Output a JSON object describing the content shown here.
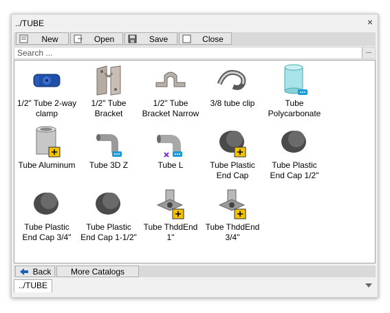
{
  "window": {
    "title": "../TUBE",
    "close_glyph": "×"
  },
  "toolbar": {
    "new_label": "New",
    "open_label": "Open",
    "save_label": "Save",
    "close_label": "Close"
  },
  "search": {
    "placeholder": "Search ...",
    "value": "",
    "options_label": "..."
  },
  "items": [
    {
      "label": "1/2\" Tube  2-way clamp",
      "icon": "blue-clamp"
    },
    {
      "label": "1/2\" Tube Bracket",
      "icon": "bracket"
    },
    {
      "label": "1/2\" Tube Bracket Narrow",
      "icon": "bracket-narrow"
    },
    {
      "label": "3/8 tube clip",
      "icon": "clip"
    },
    {
      "label": "Tube Polycarbonate",
      "icon": "polycarbonate-tube"
    },
    {
      "label": "Tube Aluminum",
      "icon": "aluminum-tube"
    },
    {
      "label": "Tube 3D Z",
      "icon": "elbow-z"
    },
    {
      "label": "Tube L",
      "icon": "elbow-l"
    },
    {
      "label": "Tube Plastic End Cap",
      "icon": "end-cap"
    },
    {
      "label": "Tube Plastic End Cap 1/2\"",
      "icon": "end-cap"
    },
    {
      "label": "Tube Plastic End Cap 3/4\"",
      "icon": "end-cap"
    },
    {
      "label": "Tube Plastic End Cap 1-1/2\"",
      "icon": "end-cap"
    },
    {
      "label": "Tube ThddEnd 1\"",
      "icon": "threaded-end"
    },
    {
      "label": "Tube ThddEnd 3/4\"",
      "icon": "threaded-end"
    }
  ],
  "bottom": {
    "back_label": "Back",
    "more_label": "More Catalogs"
  },
  "path_tab": {
    "label": "../TUBE"
  }
}
